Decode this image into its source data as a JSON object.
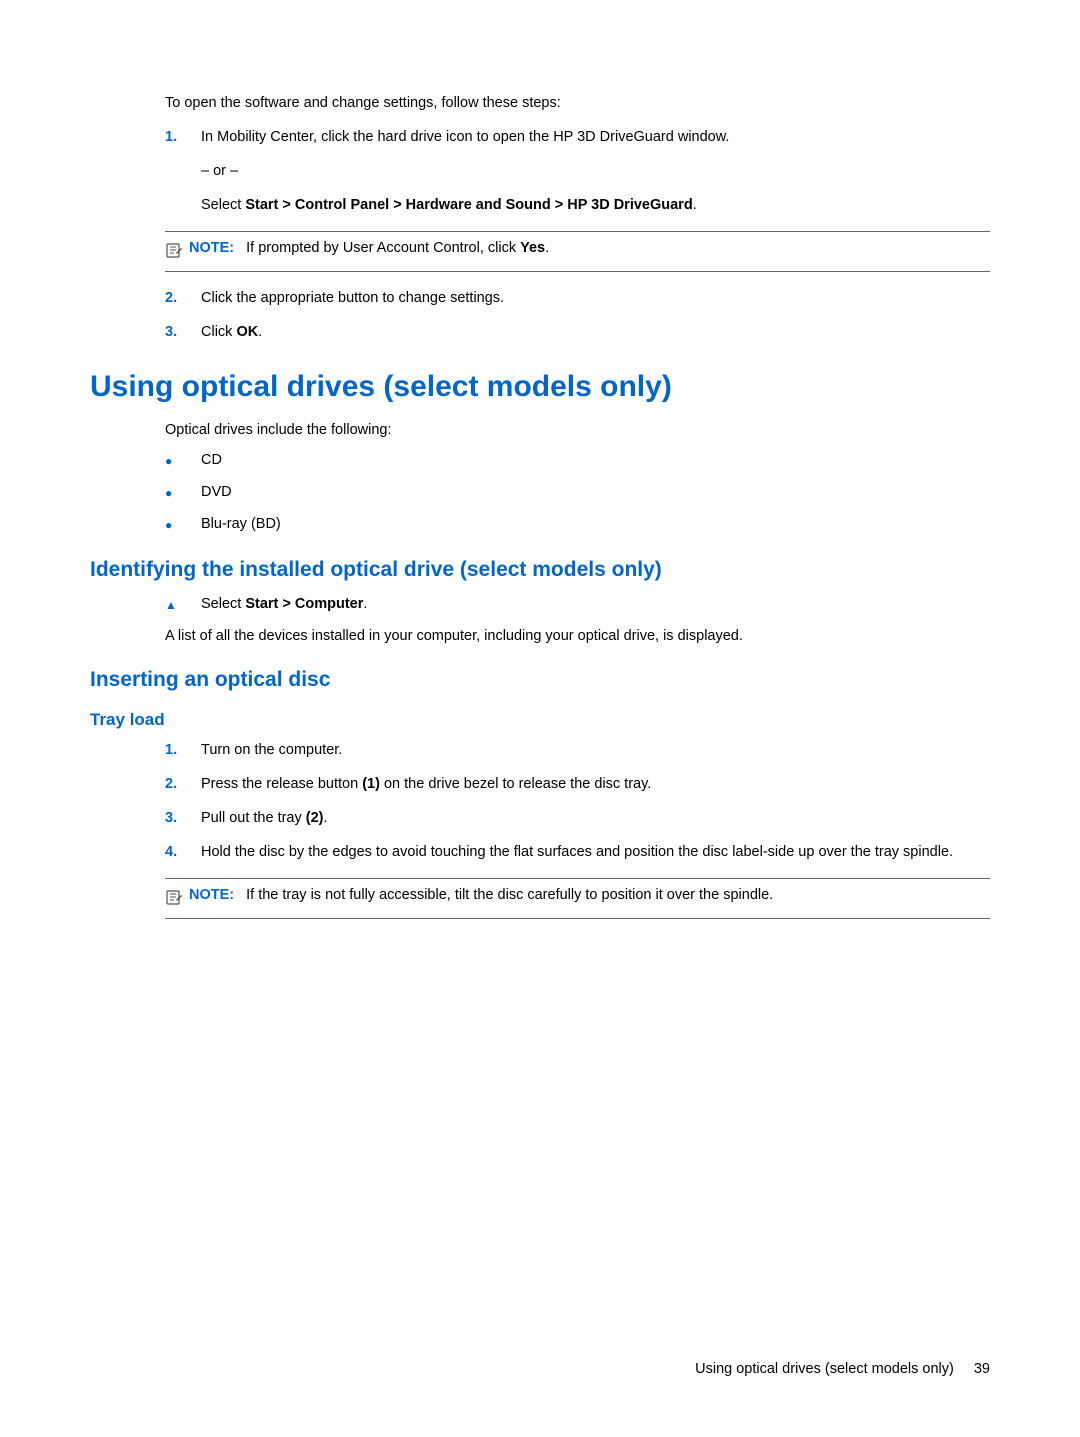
{
  "section1": {
    "intro": "To open the software and change settings, follow these steps:",
    "steps": {
      "s1": {
        "num": "1.",
        "line1": "In Mobility Center, click the hard drive icon to open the HP 3D DriveGuard window.",
        "or": "– or –",
        "select_prefix": "Select ",
        "select_bold": "Start > Control Panel > Hardware and Sound > HP 3D DriveGuard",
        "select_suffix": "."
      },
      "note1": {
        "label": "NOTE:",
        "text_prefix": "If prompted by User Account Control, click ",
        "text_bold": "Yes",
        "text_suffix": "."
      },
      "s2": {
        "num": "2.",
        "text": "Click the appropriate button to change settings."
      },
      "s3": {
        "num": "3.",
        "prefix": "Click ",
        "bold": "OK",
        "suffix": "."
      }
    }
  },
  "h1": "Using optical drives (select models only)",
  "optical_intro": "Optical drives include the following:",
  "bullets": {
    "b1": "CD",
    "b2": "DVD",
    "b3": "Blu-ray (BD)"
  },
  "h2a": "Identifying the installed optical drive (select models only)",
  "triangle1": {
    "prefix": "Select ",
    "bold": "Start > Computer",
    "suffix": "."
  },
  "identify_text": "A list of all the devices installed in your computer, including your optical drive, is displayed.",
  "h2b": "Inserting an optical disc",
  "h3": "Tray load",
  "tray": {
    "s1": {
      "num": "1.",
      "text": "Turn on the computer."
    },
    "s2": {
      "num": "2.",
      "p1": "Press the release button ",
      "b1": "(1)",
      "p2": " on the drive bezel to release the disc tray."
    },
    "s3": {
      "num": "3.",
      "p1": "Pull out the tray ",
      "b1": "(2)",
      "p2": "."
    },
    "s4": {
      "num": "4.",
      "text": "Hold the disc by the edges to avoid touching the flat surfaces and position the disc label-side up over the tray spindle."
    },
    "note": {
      "label": "NOTE:",
      "text": "If the tray is not fully accessible, tilt the disc carefully to position it over the spindle."
    }
  },
  "footer": {
    "text": "Using optical drives (select models only)",
    "page": "39"
  }
}
